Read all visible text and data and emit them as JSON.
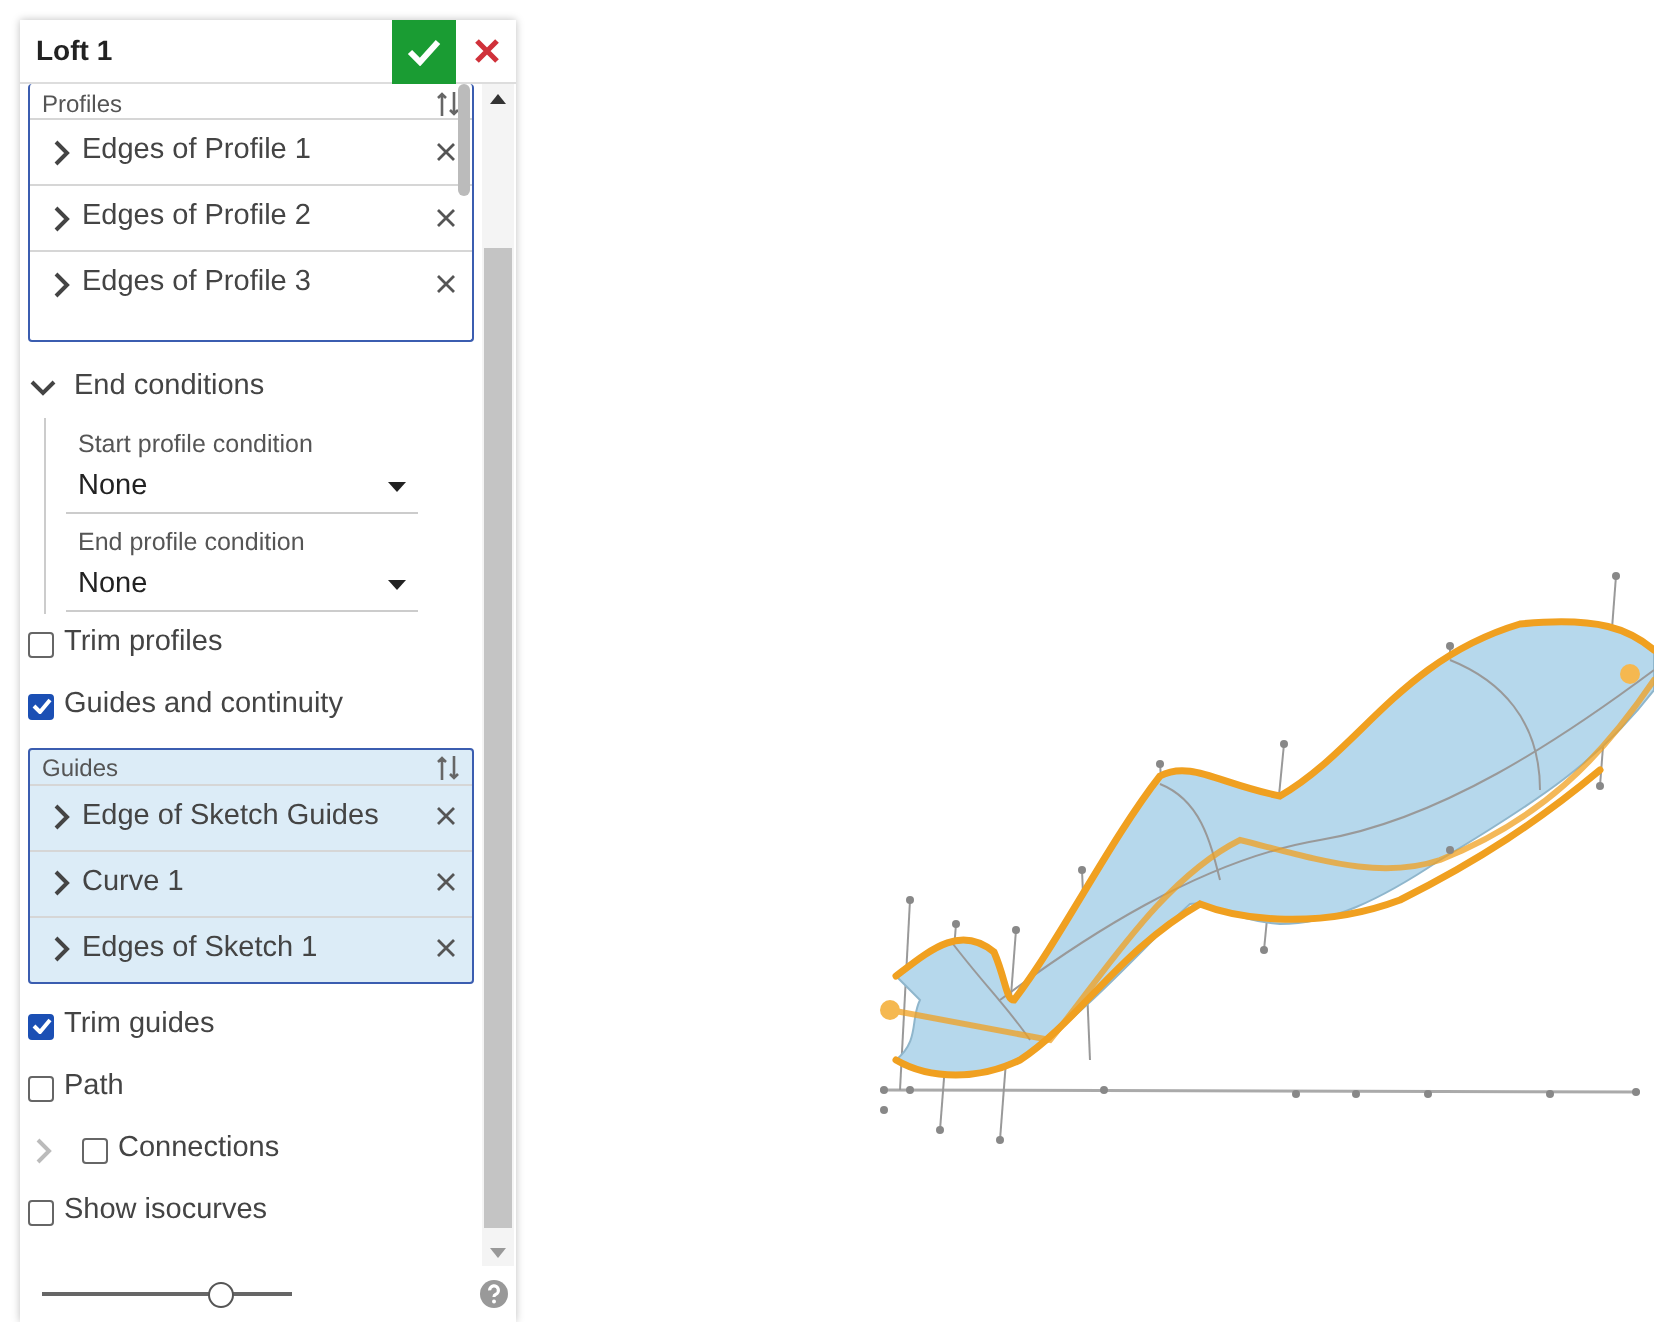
{
  "dialog": {
    "title": "Loft 1"
  },
  "profiles": {
    "label": "Profiles",
    "selected": false,
    "items": [
      {
        "label": "Edges of Profile 1"
      },
      {
        "label": "Edges of Profile 2"
      },
      {
        "label": "Edges of Profile 3"
      }
    ]
  },
  "end_conditions": {
    "label": "End conditions",
    "expanded": true,
    "fields": [
      {
        "label": "Start profile condition",
        "value": "None"
      },
      {
        "label": "End profile condition",
        "value": "None"
      }
    ]
  },
  "trim_profiles": {
    "label": "Trim profiles",
    "checked": false
  },
  "guides_and_continuity": {
    "label": "Guides and continuity",
    "checked": true
  },
  "guides": {
    "label": "Guides",
    "selected": true,
    "items": [
      {
        "label": "Edge of Sketch Guides"
      },
      {
        "label": "Curve 1"
      },
      {
        "label": "Edges of Sketch 1"
      }
    ]
  },
  "trim_guides": {
    "label": "Trim guides",
    "checked": true
  },
  "path": {
    "label": "Path",
    "checked": false
  },
  "connections": {
    "label": "Connections",
    "checked": false,
    "expanded": false
  },
  "show_isocurves": {
    "label": "Show isocurves",
    "checked": false
  },
  "slider": {
    "level": 0.72
  }
}
